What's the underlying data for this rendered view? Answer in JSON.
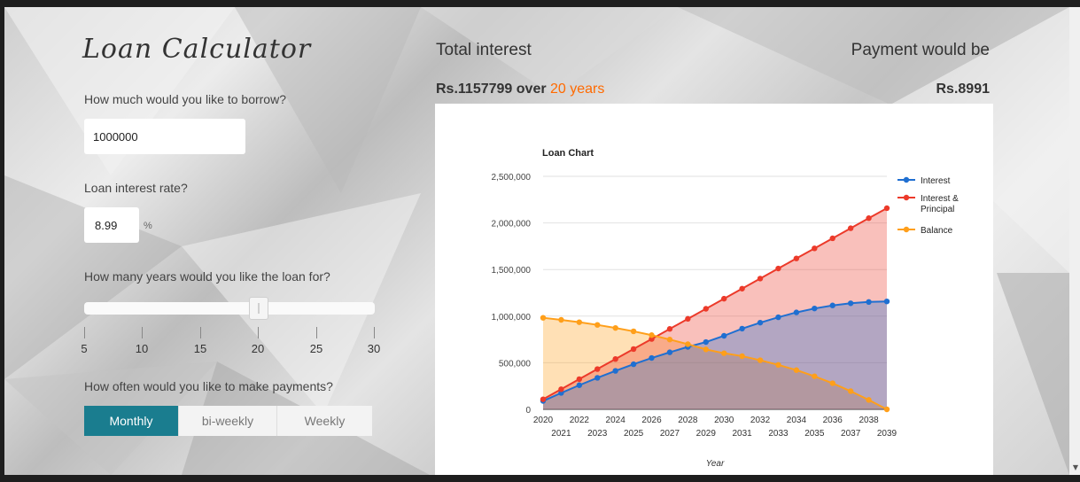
{
  "app": {
    "title": "Loan Calculator"
  },
  "borrow": {
    "label": "How much would you like to borrow?",
    "value": "1000000"
  },
  "rate": {
    "label": "Loan interest rate?",
    "value": "8.99",
    "unit": "%"
  },
  "years": {
    "label": "How many years would you like the loan for?",
    "ticks": [
      "5",
      "10",
      "15",
      "20",
      "25",
      "30"
    ],
    "selected": 20
  },
  "frequency": {
    "label": "How often would you like to make payments?",
    "options": [
      "Monthly",
      "bi-weekly",
      "Weekly"
    ],
    "selected": "Monthly"
  },
  "summary": {
    "total_interest_label": "Total interest",
    "total_interest_value": "Rs.1157799",
    "over_text": "over",
    "years_text": "20 years",
    "payment_label": "Payment would be",
    "payment_value": "Rs.8991"
  },
  "colors": {
    "accent": "#1a7d8f",
    "highlight": "#ff6a00",
    "interest": "#1f6fd1",
    "interest_principal": "#ec3a2a",
    "balance": "#ff9f1a"
  },
  "chart_data": {
    "type": "area",
    "title": "Loan Chart",
    "xlabel": "Year",
    "ylabel": "",
    "ylim": [
      0,
      2500000
    ],
    "yticks": [
      "0",
      "500,000",
      "1,000,000",
      "1,500,000",
      "2,000,000",
      "2,500,000"
    ],
    "x": [
      2020,
      2021,
      2022,
      2023,
      2024,
      2025,
      2026,
      2027,
      2028,
      2029,
      2030,
      2031,
      2032,
      2033,
      2034,
      2035,
      2036,
      2037,
      2038,
      2039
    ],
    "legend_position": "right",
    "series": [
      {
        "name": "Interest",
        "color": "#1f6fd1",
        "values": [
          90000,
          176000,
          259000,
          338000,
          413000,
          484000,
          551000,
          612000,
          670000,
          722000,
          789000,
          866000,
          930000,
          988000,
          1040000,
          1082000,
          1115000,
          1138000,
          1152000,
          1157800
        ]
      },
      {
        "name": "Interest & Principal",
        "color": "#ec3a2a",
        "values": [
          108000,
          216000,
          324000,
          432000,
          540000,
          647000,
          755000,
          863000,
          971000,
          1079000,
          1187000,
          1295000,
          1403000,
          1511000,
          1619000,
          1727000,
          1835000,
          1943000,
          2051000,
          2158000
        ]
      },
      {
        "name": "Balance",
        "color": "#ff9f1a",
        "values": [
          982000,
          960000,
          935000,
          906000,
          873000,
          837000,
          796000,
          749000,
          699000,
          643000,
          602000,
          571000,
          527000,
          477000,
          421000,
          355000,
          280000,
          195000,
          101000,
          0
        ]
      }
    ]
  }
}
